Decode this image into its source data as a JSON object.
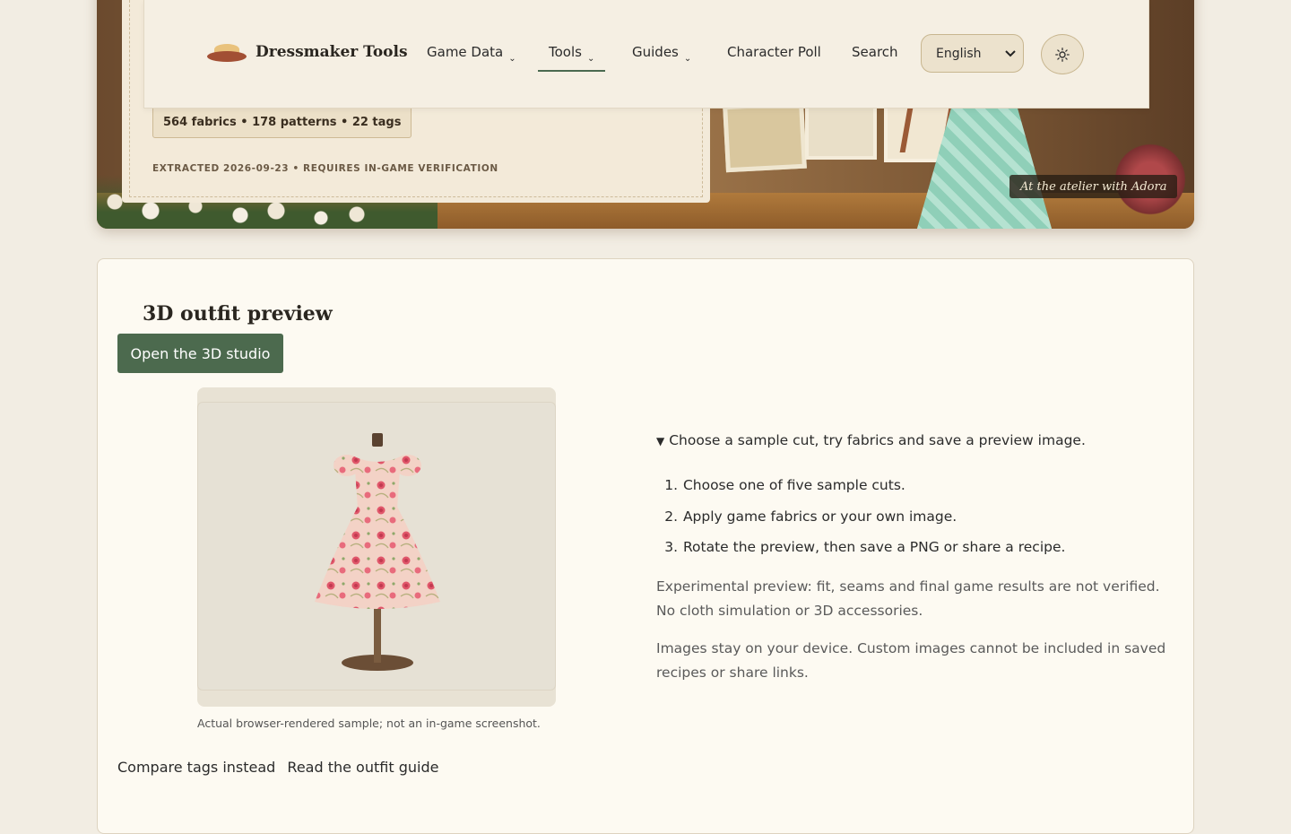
{
  "nav": {
    "brand": "Dressmaker Tools",
    "items": [
      {
        "label": "Game Data",
        "has_menu": true
      },
      {
        "label": "Tools",
        "has_menu": true,
        "active": true
      },
      {
        "label": "Guides",
        "has_menu": true
      },
      {
        "label": "Character Poll",
        "has_menu": false
      },
      {
        "label": "Search",
        "has_menu": false
      }
    ],
    "language": "English",
    "theme_icon": "sun-icon"
  },
  "hero": {
    "stats": "564 fabrics • 178 patterns • 22 tags",
    "extracted": "EXTRACTED 2026-09-23 • REQUIRES IN-GAME VERIFICATION",
    "caption": "At the atelier with Adora"
  },
  "preview_section": {
    "title": "3D outfit preview",
    "open_button": "Open the 3D studio",
    "image_caption": "Actual browser-rendered sample; not an in-game screenshot.",
    "summary": "Choose a sample cut, try fabrics and save a preview image.",
    "steps": [
      "Choose one of five sample cuts.",
      "Apply game fabrics or your own image.",
      "Rotate the preview, then save a PNG or share a recipe."
    ],
    "note1": "Experimental preview: fit, seams and final game results are not verified. No cloth simulation or 3D accessories.",
    "note2": "Images stay on your device. Custom images cannot be included in saved recipes or share links.",
    "links": [
      "Compare tags instead",
      "Read the outfit guide"
    ]
  },
  "colors": {
    "page_bg": "#f2ede3",
    "accent_green": "#4c6a4e",
    "card_bg": "#fdfaf2",
    "dress_pink": "#f3cfc3",
    "rose": "#e0566a"
  }
}
